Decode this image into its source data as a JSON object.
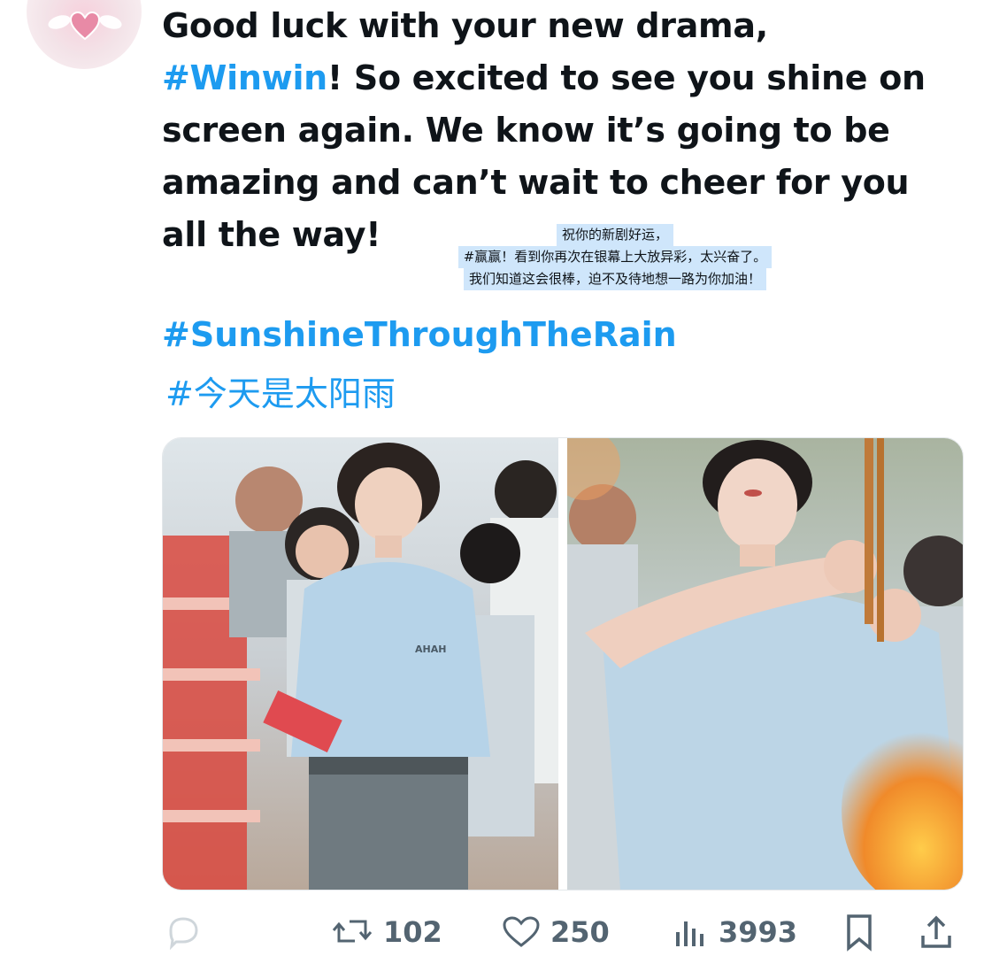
{
  "tweet": {
    "line1": "Good luck with your new drama,",
    "hashtag_winwin": "#Winwin",
    "line2_rest": "! So excited to see you shine on",
    "line3": "screen again. We know it’s going to be",
    "line4": "amazing and can’t wait to cheer for you",
    "line5": "all the way!"
  },
  "translation": {
    "line1": "祝你的新剧好运，",
    "line2": "#赢赢！看到你再次在银幕上大放异彩，太兴奋了。",
    "line3": "我们知道这会很棒，迫不及待地想一路为你加油！"
  },
  "hashtags": {
    "tag1": "#SunshineThroughTheRain",
    "tag2": "#今天是太阳雨"
  },
  "media": {
    "photo1_shirt_text": "AHAH"
  },
  "actions": {
    "retweets": "102",
    "likes": "250",
    "views": "3993"
  },
  "colors": {
    "accent": "#1d9bf0",
    "text": "#0f1419",
    "muted": "#536471",
    "translation_highlight": "#cfe6fb"
  },
  "icons": [
    "reply-icon",
    "retweet-icon",
    "like-icon",
    "views-icon",
    "bookmark-icon",
    "share-icon"
  ]
}
